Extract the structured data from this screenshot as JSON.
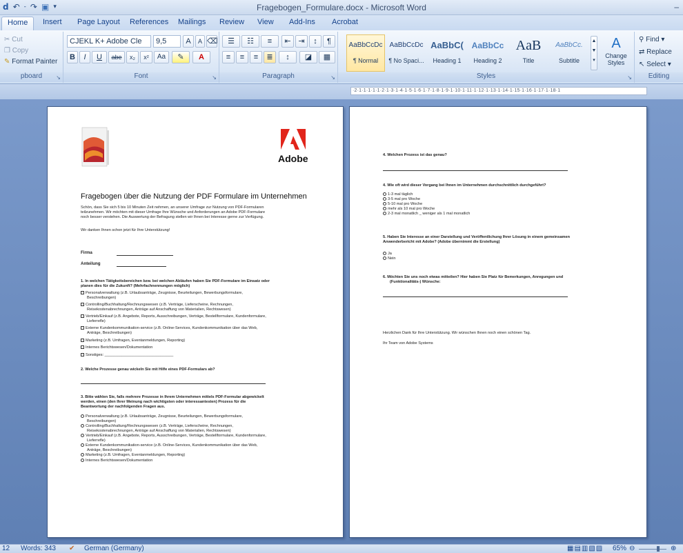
{
  "window": {
    "title": "Fragebogen_Formulare.docx - Microsoft Word",
    "qat_icons": [
      "word-app-icon",
      "undo-icon",
      "redo-icon",
      "save-icon"
    ],
    "minimize": "–"
  },
  "tabs": [
    {
      "label": "Home",
      "active": true
    },
    {
      "label": "Insert"
    },
    {
      "label": "Page Layout"
    },
    {
      "label": "References"
    },
    {
      "label": "Mailings"
    },
    {
      "label": "Review"
    },
    {
      "label": "View"
    },
    {
      "label": "Add-Ins"
    },
    {
      "label": "Acrobat"
    }
  ],
  "ribbon": {
    "clipboard": {
      "cut": "Cut",
      "copy": "Copy",
      "format_painter": "Format Painter",
      "label": "pboard"
    },
    "font": {
      "font_name": "CJEKL K+ Adobe Cle",
      "font_size": "9,5",
      "label": "Font",
      "buttons": {
        "bold": "B",
        "italic": "I",
        "underline": "U",
        "strike": "abe",
        "sub": "x₂",
        "sup": "x²",
        "case": "Aa",
        "grow": "A",
        "shrink": "A"
      }
    },
    "paragraph": {
      "label": "Paragraph"
    },
    "styles": {
      "label": "Styles",
      "items": [
        {
          "preview": "AaBbCcDc",
          "name": "¶ Normal",
          "selected": true
        },
        {
          "preview": "AaBbCcDc",
          "name": "¶ No Spaci..."
        },
        {
          "preview": "AaBbC(",
          "name": "Heading 1"
        },
        {
          "preview": "AaBbCc",
          "name": "Heading 2"
        },
        {
          "preview": "AaB",
          "name": "Title"
        },
        {
          "preview": "AaBbCc.",
          "name": "Subtitle"
        }
      ],
      "change_styles": "Change Styles"
    },
    "editing": {
      "label": "Editing",
      "find": "Find",
      "replace": "Replace",
      "select": "Select"
    }
  },
  "ruler": {
    "text": "·2·1·1·1·1·1·2·1·3·1·4·1·5·1·6·1·7·1·8·1·9·1·10·1·11·1·12·1·13·1·14·1·15·1·16·1·17·1·18·1"
  },
  "page1": {
    "heading": "Fragebogen über die Nutzung der PDF Formulare im Unternehmen",
    "logo_text": "Adobe",
    "intro": [
      "Schön, dass Sie sich 5 bis 10 Minuten Zeit nehmen, an unserer Umfrage zur Nutzung von PDF-Formularen",
      "teilzunehmen. Wir möchten mit dieser Umfrage Ihre Wünsche und Anforderungen an Adobe PDF-Formulare",
      "noch besser verstehen. Die Auswertung der Befragung stellen wir Ihnen bei Interesse gerne zur Verfügung."
    ],
    "thanks": "Wir danken Ihnen schon jetzt für Ihre Unterstützung!",
    "firma_label": "Firma",
    "anteilung_label": "Anteilung",
    "q1": [
      "1. In welchen Tätigkeitsbereichen bzw. bei welchen Abläufen haben Sie PDF-Formulare im Einsatz oder",
      "planen dies für die Zukunft? (Mehrfachnennungen möglich)"
    ],
    "q1_options": [
      [
        "Personalverwaltung (z.B. Urlaubsanträge, Zeugnisse, Beurteilungen, Bewerbungsformulare,",
        "Beschreibungen)"
      ],
      [
        "Controlling/Buchhaltung/Rechnungswesen (z.B. Verträge, Lieferscheine, Rechnungen,",
        "Reisekostenabrechnungen, Anträge auf Anschaffung von Materialien, Rechtswesen)"
      ],
      [
        "Vertrieb/Einkauf (z.B. Angebote, Reports, Ausschreibungen, Verträge, Bestellformulare, Kundenformulare,",
        "Lieferrefle)"
      ],
      [
        "Externe Kundenkommunikation-service (z.B. Online-Services, Kundenkommunikation über das Web,",
        "Anträge, Beschreibungen)"
      ],
      [
        "Marketing (z.B. Umfragen, Eventanmeldungen, Reporting)"
      ],
      [
        "Internes Berichtswesen/Dokumentation"
      ],
      [
        "Sonstiges: ________________________________"
      ]
    ],
    "q2": "2. Welche Prozesse genau wickeln Sie mit Hilfe eines PDF-Formulars ab?",
    "q3": [
      "3. Bitte wählen Sie, falls mehrere Prozesse in Ihrem Unternehmen mittels PDF-Formular abgewickelt",
      "werden, einen (den Ihrer Meinung nach wichtigsten oder interessantesten) Prozess für die",
      "Beantwortung der nachfolgenden Fragen aus."
    ],
    "q3_options": [
      [
        "Personalverwaltung (z.B. Urlaubsanträge, Zeugnisse, Beurteilungen, Bewerbungsformulare,",
        "Beschreibungen)"
      ],
      [
        "Controlling/Buchhaltung/Rechnungswesen (z.B. Verträge, Lieferscheine, Rechnungen,",
        "Reisekostenabrechnungen, Anträge auf Anschaffung von Materialien, Rechtswesen)"
      ],
      [
        "Vertrieb/Einkauf (z.B. Angebote, Reports, Ausschreibungen, Verträge, Bestellformulare, Kundenformulare,",
        "Lieferrefle)"
      ],
      [
        "Externe Kundenkommunikation-service (z.B. Online-Services, Kundenkommunikation über das Web,",
        "Anträge, Beschreibungen)"
      ],
      [
        "Marketing (z.B. Umfragen, Eventanmeldungen, Reporting)"
      ],
      [
        "Internes Berichtswesen/Dokumentation"
      ]
    ]
  },
  "page2": {
    "q4": "4. Welchen Prozess ist das genau?",
    "q5": "4. Wie oft wird dieser Vorgang bei Ihnen im Unternehmen durchschnittlich durchgeführt?",
    "q5_options": [
      "1-3 mal täglich",
      "3-5 mal pro Woche",
      "5-10 mal pro Woche",
      "mehr als 10 mal pro Woche",
      "2-3 mal monatlich  _  weniger als 1 mal monatlich"
    ],
    "q6": [
      "5. Haben Sie Interesse an einer Darstellung und Veröffentlichung Ihrer Lösung in einem gemeinsamen",
      "Anwenderbericht mit Adobe? (Adobe übernimmt die Erstellung)"
    ],
    "q6_options": [
      "Ja",
      "Nein"
    ],
    "q7": [
      "6. Möchten Sie uns noch etwas mitteilen? Hier haben Sie Platz für Bemerkungen, Anregungen und",
      "(Funktionalitäts-) Wünsche:"
    ],
    "closing": "Herzlichen Dank für Ihre Unterstützung. Wir wünschen Ihnen noch einen schönen Tag.",
    "sign": "Ihr Team von Adobe Systems"
  },
  "status": {
    "page": "12",
    "words": "Words: 343",
    "language": "German (Germany)",
    "zoom": "65%"
  }
}
